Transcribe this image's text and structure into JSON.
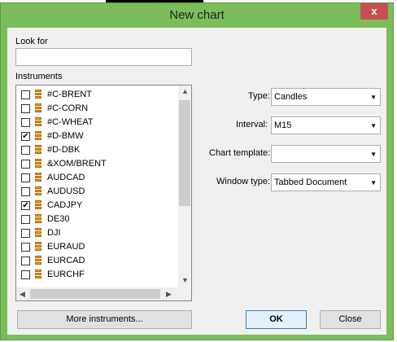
{
  "window": {
    "title": "New chart",
    "close_symbol": "x"
  },
  "look_for": {
    "label": "Look for",
    "value": ""
  },
  "instruments": {
    "label": "Instruments",
    "items": [
      {
        "name": "#C-BRENT",
        "checked": false
      },
      {
        "name": "#C-CORN",
        "checked": false
      },
      {
        "name": "#C-WHEAT",
        "checked": false
      },
      {
        "name": "#D-BMW",
        "checked": true
      },
      {
        "name": "#D-DBK",
        "checked": false
      },
      {
        "name": "&XOM/BRENT",
        "checked": false
      },
      {
        "name": "AUDCAD",
        "checked": false
      },
      {
        "name": "AUDUSD",
        "checked": false
      },
      {
        "name": "CADJPY",
        "checked": true
      },
      {
        "name": "DE30",
        "checked": false
      },
      {
        "name": "DJI",
        "checked": false
      },
      {
        "name": "EURAUD",
        "checked": false
      },
      {
        "name": "EURCAD",
        "checked": false
      },
      {
        "name": "EURCHF",
        "checked": false
      }
    ]
  },
  "form": {
    "type": {
      "label": "Type:",
      "value": "Candles"
    },
    "interval": {
      "label": "Interval:",
      "value": "M15"
    },
    "chart_template": {
      "label": "Chart template:",
      "value": ""
    },
    "window_type": {
      "label": "Window type:",
      "value": "Tabbed Document"
    }
  },
  "buttons": {
    "more": "More instruments...",
    "ok": "OK",
    "close": "Close"
  },
  "colors": {
    "titlebar": "#7bbd5b",
    "close_button": "#c75050",
    "ok_border": "#3c7fb1"
  },
  "icons": {
    "instrument": "instrument-stack-icon",
    "dropdown": "chevron-down-icon"
  }
}
